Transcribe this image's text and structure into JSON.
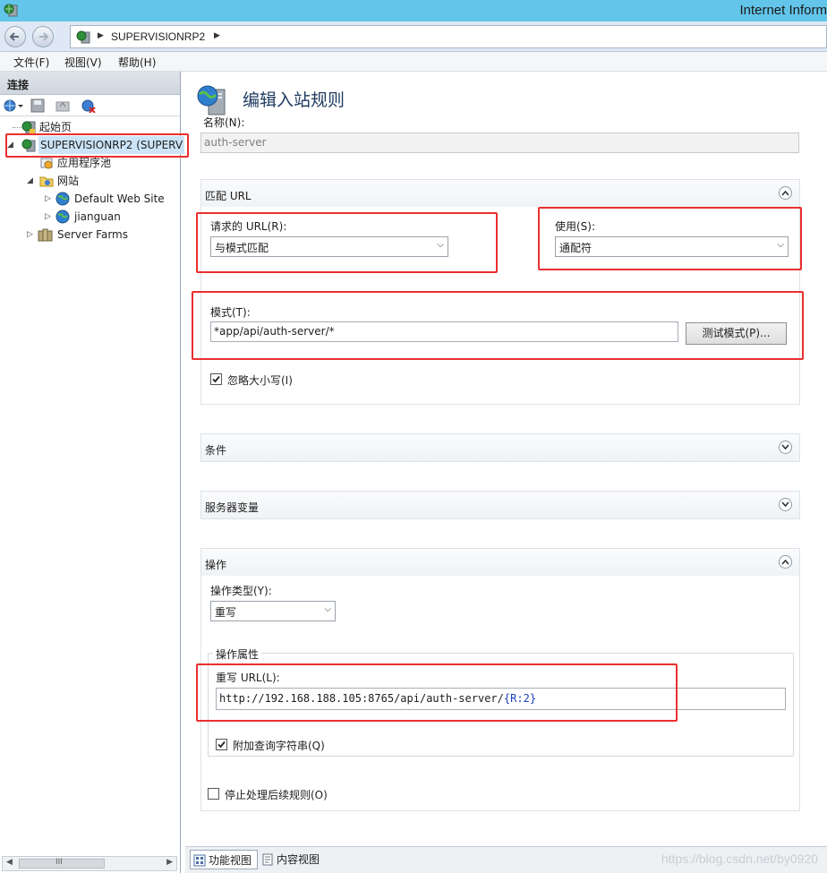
{
  "window": {
    "title": "Internet Inform"
  },
  "address_bar": {
    "crumbs": [
      "SUPERVISIONRP2"
    ]
  },
  "menu": {
    "items": [
      "文件(F)",
      "视图(V)",
      "帮助(H)"
    ]
  },
  "connections": {
    "header": "连接",
    "tree": [
      {
        "label": "起始页",
        "icon": "start-page-icon"
      },
      {
        "label": "SUPERVISIONRP2 (SUPERV",
        "icon": "server-icon"
      },
      {
        "label": "应用程序池",
        "icon": "app-pool-icon"
      },
      {
        "label": "网站",
        "icon": "sites-folder-icon"
      },
      {
        "label": "Default Web Site",
        "icon": "globe-icon"
      },
      {
        "label": "jianguan",
        "icon": "globe-icon"
      },
      {
        "label": "Server Farms",
        "icon": "server-farms-icon"
      }
    ],
    "scrollbar_label": "III"
  },
  "page": {
    "title": "编辑入站规则",
    "name_label": "名称(N):",
    "name_value": "auth-server",
    "match_url": {
      "title": "匹配 URL",
      "requested_url_label": "请求的 URL(R):",
      "requested_url_value": "与模式匹配",
      "using_label": "使用(S):",
      "using_value": "通配符",
      "pattern_label": "模式(T):",
      "pattern_value": "*app/api/auth-server/*",
      "test_button": "测试模式(P)...",
      "ignore_case_label": "忽略大小写(I)",
      "ignore_case_checked": true
    },
    "conditions": {
      "title": "条件"
    },
    "server_variables": {
      "title": "服务器变量"
    },
    "action": {
      "title": "操作",
      "type_label": "操作类型(Y):",
      "type_value": "重写",
      "properties_title": "操作属性",
      "rewrite_url_label": "重写 URL(L):",
      "rewrite_url_prefix": "http://192.168.188.105:8765/api/auth-server/",
      "rewrite_url_brace_open": "{",
      "rewrite_url_var": "R:2",
      "rewrite_url_brace_close": "}",
      "append_query_label": "附加查询字符串(Q)",
      "append_query_checked": true,
      "stop_processing_label": "停止处理后续规则(O)",
      "stop_processing_checked": false
    }
  },
  "statusbar": {
    "features_view": "功能视图",
    "content_view": "内容视图",
    "watermark": "https://blog.csdn.net/by0920"
  },
  "colors": {
    "highlight_red": "#ea2f2f",
    "title_bar": "#62c5e9",
    "variable_blue": "#1a3fbf"
  }
}
